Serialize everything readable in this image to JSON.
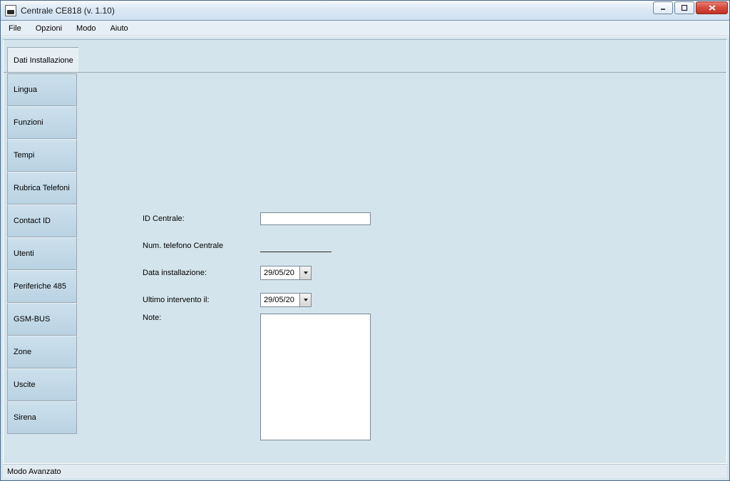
{
  "window": {
    "title": "Centrale CE818 (v. 1.10)"
  },
  "menu": {
    "file": "File",
    "opzioni": "Opzioni",
    "modo": "Modo",
    "aiuto": "Aiuto"
  },
  "tab": {
    "header": "Dati Installazione"
  },
  "sidenav": {
    "items": [
      {
        "label": "Lingua"
      },
      {
        "label": "Funzioni"
      },
      {
        "label": "Tempi"
      },
      {
        "label": "Rubrica Telefoni"
      },
      {
        "label": "Contact ID"
      },
      {
        "label": "Utenti"
      },
      {
        "label": "Periferiche 485"
      },
      {
        "label": "GSM-BUS"
      },
      {
        "label": "Zone"
      },
      {
        "label": "Uscite"
      },
      {
        "label": "Sirena"
      }
    ]
  },
  "form": {
    "id_centrale_label": "ID Centrale:",
    "id_centrale_value": "",
    "num_telefono_label": "Num. telefono Centrale",
    "num_telefono_value": "",
    "data_installazione_label": "Data installazione:",
    "data_installazione_value": "29/05/20",
    "ultimo_intervento_label": "Ultimo intervento il:",
    "ultimo_intervento_value": "29/05/20",
    "note_label": "Note:",
    "note_value": ""
  },
  "status": {
    "text": "Modo Avanzato"
  }
}
